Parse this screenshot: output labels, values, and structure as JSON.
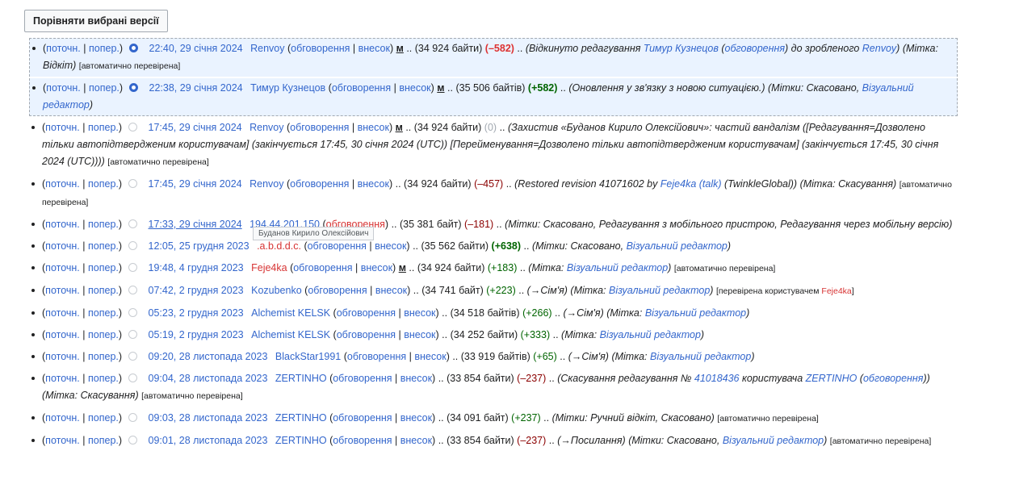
{
  "compare_button": "Порівняти вибрані версії",
  "tooltip": "Буданов Кирило Олексійович",
  "common": {
    "cur": "поточн.",
    "sep": "|",
    "prev": "попер.",
    "talk": "обговорення",
    "contribs": "внесок",
    "minor": "м",
    "dots": "..",
    "patrolled": "[автоматично перевірена]"
  },
  "rows": [
    {
      "date": "22:40, 29 січня 2024",
      "user": "Renvoy",
      "size": "(34 924 байти)",
      "diff": "(–582)",
      "summary_a": "(Відкинуто редагування ",
      "summary_user": "Тимур Кузнецов",
      "summary_talk": "обговорення",
      "summary_b": ") до зробленого ",
      "summary_user2": "Renvoy",
      "summary_c": ")",
      "tag_label": "(Мітка: ",
      "tag": "Відкіт",
      "tag_end": ")",
      "patrolled": "[автоматично перевірена]"
    },
    {
      "date": "22:38, 29 січня 2024",
      "user": "Тимур Кузнецов",
      "size": "(35 506 байтів)",
      "diff": "(+582)",
      "summary": "(Оновлення у зв'язку з новою ситуацією.)",
      "tag_label": "(Мітки: ",
      "tag1": "Скасовано",
      "tag2": "Візуальний редактор",
      "tag_end": ")"
    },
    {
      "date": "17:45, 29 січня 2024",
      "user": "Renvoy",
      "size": "(34 924 байти)",
      "diff": "(0)",
      "summary": "(Захистив «Буданов Кирило Олексійович»: частий вандалізм ([Редагування=Дозволено тільки автопідтвердженим користувачам] (закінчується 17:45, 30 січня 2024 (UTC)) [Перейменування=Дозволено тільки автопідтвердженим користувачам] (закінчується 17:45, 30 січня 2024 (UTC))))",
      "patrolled": "[автоматично перевірена]"
    },
    {
      "date": "17:45, 29 січня 2024",
      "user": "Renvoy",
      "size": "(34 924 байти)",
      "diff": "(–457)",
      "summary_a": "(Restored revision 41071602 by ",
      "summary_user": "Feje4ka",
      "summary_talk": "(talk)",
      "summary_b": " (TwinkleGlobal))",
      "tag_label": "(Мітка: ",
      "tag": "Скасування",
      "tag_end": ")",
      "patrolled": "[автоматично перевірена]"
    },
    {
      "date": "17:33, 29 січня 2024",
      "user": "194.44.201.150",
      "size": "(35 381 байт)",
      "diff": "(–181)",
      "tags": "(Мітки: Скасовано, Редагування з мобільного пристрою, Редагування через мобільну версію)"
    },
    {
      "date": "12:05, 25 грудня 2023",
      "user": ".a.b.d.d.c.",
      "size": "(35 562 байти)",
      "diff": "(+638)",
      "tag_label": "(Мітки: ",
      "tag1": "Скасовано",
      "tag2": "Візуальний редактор",
      "tag_end": ")"
    },
    {
      "date": "19:48, 4 грудня 2023",
      "user": "Feje4ka",
      "size": "(34 924 байти)",
      "diff": "(+183)",
      "tag_label": "(Мітка: ",
      "tag": "Візуальний редактор",
      "tag_end": ")",
      "patrolled": "[автоматично перевірена]"
    },
    {
      "date": "07:42, 2 грудня 2023",
      "user": "Kozubenko",
      "size": "(34 741 байт)",
      "diff": "(+223)",
      "summary": "(→Сім'я)",
      "tag_label": "(Мітка: ",
      "tag": "Візуальний редактор",
      "tag_end": ")",
      "patrolled_a": "[перевірена користувачем ",
      "patrolled_user": "Feje4ka",
      "patrolled_b": "]"
    },
    {
      "date": "05:23, 2 грудня 2023",
      "user": "Alchemist KELSK",
      "size": "(34 518 байтів)",
      "diff": "(+266)",
      "summary": "(→Сім'я)",
      "tag_label": "(Мітка: ",
      "tag": "Візуальний редактор",
      "tag_end": ")"
    },
    {
      "date": "05:19, 2 грудня 2023",
      "user": "Alchemist KELSK",
      "size": "(34 252 байти)",
      "diff": "(+333)",
      "tag_label": "(Мітка: ",
      "tag": "Візуальний редактор",
      "tag_end": ")"
    },
    {
      "date": "09:20, 28 листопада 2023",
      "user": "BlackStar1991",
      "size": "(33 919 байтів)",
      "diff": "(+65)",
      "summary": "(→Сім'я)",
      "tag_label": "(Мітка: ",
      "tag": "Візуальний редактор",
      "tag_end": ")"
    },
    {
      "date": "09:04, 28 листопада 2023",
      "user": "ZERTINHO",
      "size": "(33 854 байти)",
      "diff": "(–237)",
      "summary_a": "(Скасування редагування № ",
      "summary_rev": "41018436",
      "summary_b": " користувача ",
      "summary_user": "ZERTINHO",
      "summary_talk": "обговорення",
      "summary_c": ")",
      "tag_label": "(Мітка: ",
      "tag": "Скасування",
      "tag_end": ")",
      "patrolled": "[автоматично перевірена]"
    },
    {
      "date": "09:03, 28 листопада 2023",
      "user": "ZERTINHO",
      "size": "(34 091 байт)",
      "diff": "(+237)",
      "tags": "(Мітки: Ручний відкіт, Скасовано)",
      "patrolled": "[автоматично перевірена]"
    },
    {
      "date": "09:01, 28 листопада 2023",
      "user": "ZERTINHO",
      "size": "(33 854 байти)",
      "diff": "(–237)",
      "summary": "(→Посилання)",
      "tag_label": "(Мітки: ",
      "tag1": "Скасовано",
      "tag2": "Візуальний редактор",
      "tag_end": ")",
      "patrolled": "[автоматично перевірена]"
    }
  ]
}
